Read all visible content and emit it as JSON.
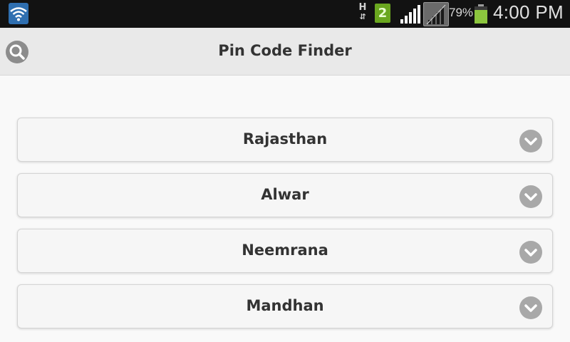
{
  "status_bar": {
    "network_type": "H",
    "sim_slot": "2",
    "battery_percent": "79%",
    "time": "4:00 PM",
    "icons": [
      "wifi-icon",
      "data-activity-icon",
      "sim-icon",
      "signal-icon",
      "signal-icon-secondary",
      "battery-icon"
    ]
  },
  "header": {
    "title": "Pin Code Finder",
    "search_icon": "search-icon"
  },
  "list": {
    "items": [
      {
        "label": "Rajasthan",
        "icon": "chevron-down-icon"
      },
      {
        "label": "Alwar",
        "icon": "chevron-down-icon"
      },
      {
        "label": "Neemrana",
        "icon": "chevron-down-icon"
      },
      {
        "label": "Mandhan",
        "icon": "chevron-down-icon"
      }
    ]
  },
  "colors": {
    "status_bar_bg": "#121212",
    "header_bg": "#e9e9e9",
    "page_bg": "#f9f9f9",
    "item_bg": "#f6f6f6",
    "icon_gray": "#a8a8a8",
    "sim_green": "#6aa71f",
    "battery_green": "#8cc63e",
    "wifi_blue": "#2f6fb0"
  }
}
